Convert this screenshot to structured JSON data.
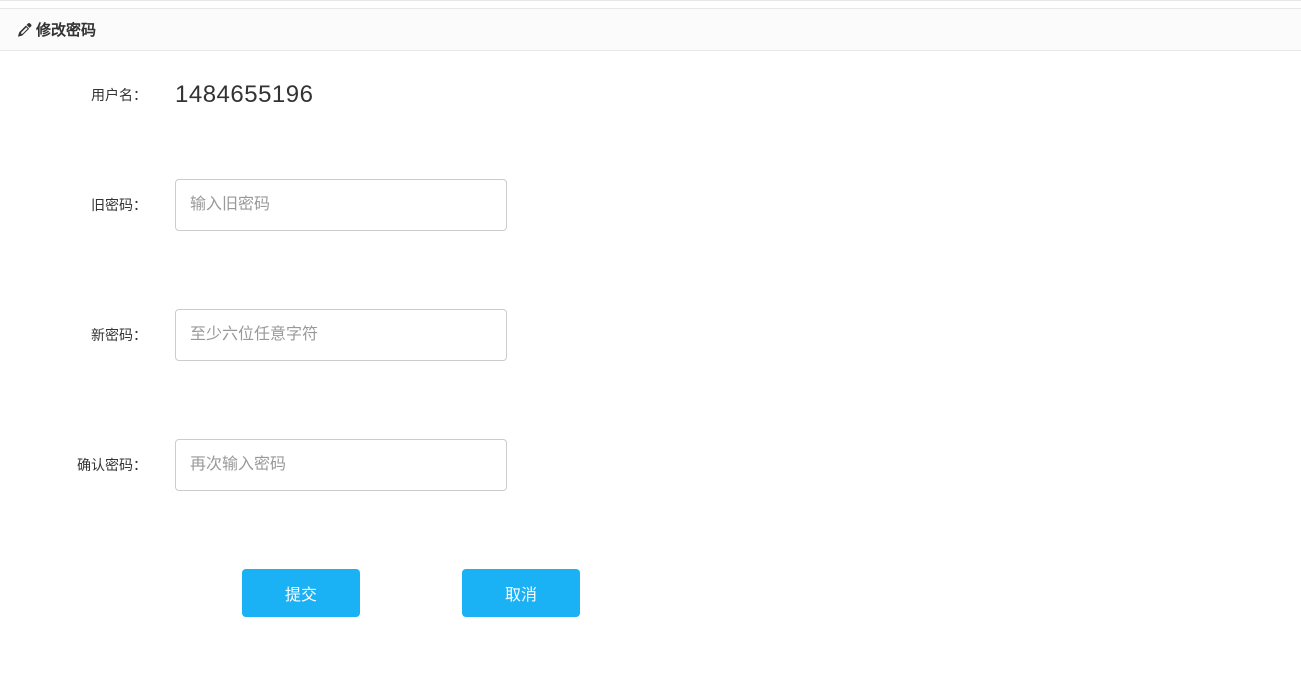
{
  "panel": {
    "title": "修改密码"
  },
  "form": {
    "username_label": "用户名：",
    "username_value": "1484655196",
    "old_password_label": "旧密码：",
    "old_password_placeholder": "输入旧密码",
    "new_password_label": "新密码：",
    "new_password_placeholder": "至少六位任意字符",
    "confirm_password_label": "确认密码：",
    "confirm_password_placeholder": "再次输入密码"
  },
  "buttons": {
    "submit": "提交",
    "cancel": "取消"
  }
}
